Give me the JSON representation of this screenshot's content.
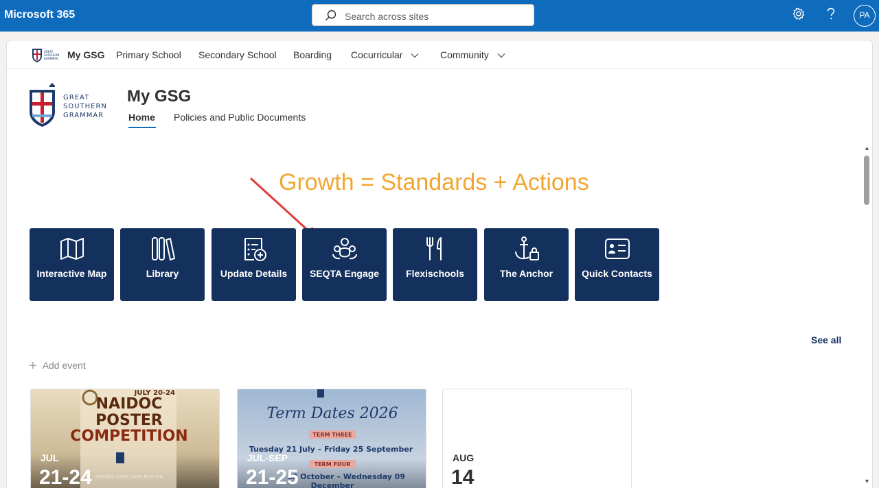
{
  "suite": {
    "brand": "Microsoft 365",
    "search_placeholder": "Search across sites",
    "avatar_initials": "PA",
    "color": "#0f6cbd"
  },
  "hub": {
    "name": "My GSG",
    "items": [
      {
        "label": "Primary School"
      },
      {
        "label": "Secondary School"
      },
      {
        "label": "Boarding"
      },
      {
        "label": "Cocurricular"
      },
      {
        "label": "Community"
      }
    ]
  },
  "site": {
    "logo_lines": [
      "GREAT",
      "SOUTHERN",
      "GRAMMAR"
    ],
    "title": "My GSG",
    "nav": [
      {
        "label": "Home"
      },
      {
        "label": "Policies and Public Documents"
      }
    ]
  },
  "tagline": "Growth = Standards + Actions",
  "tiles": [
    {
      "label": "Interactive Map",
      "icon": "map-icon"
    },
    {
      "label": "Library",
      "icon": "library-icon"
    },
    {
      "label": "Update Details",
      "icon": "update-details-icon"
    },
    {
      "label": "SEQTA Engage",
      "icon": "people-community-icon"
    },
    {
      "label": "Flexischools",
      "icon": "food-icon"
    },
    {
      "label": "The Anchor",
      "icon": "anchor-lock-icon"
    },
    {
      "label": "Quick Contacts",
      "icon": "contact-card-icon"
    }
  ],
  "tile_color": "#14305d",
  "events": {
    "see_all": "See all",
    "add_event": "Add event",
    "cards": [
      {
        "month": "JUL",
        "day": "21-24",
        "poster_lines": [
          "JULY 20-24",
          "NAIDOC",
          "POSTER",
          "COMPETITION",
          "DESIGN YOUR OWN POSTER"
        ]
      },
      {
        "month": "JUL-SEP",
        "day": "21-25",
        "poster_lines": [
          "Term Dates 2026",
          "TERM THREE",
          "Tuesday 21 July – Friday 25 September",
          "TERM FOUR",
          "13 October – Wednesday 09",
          "December"
        ]
      },
      {
        "month": "AUG",
        "day": "14"
      }
    ]
  }
}
